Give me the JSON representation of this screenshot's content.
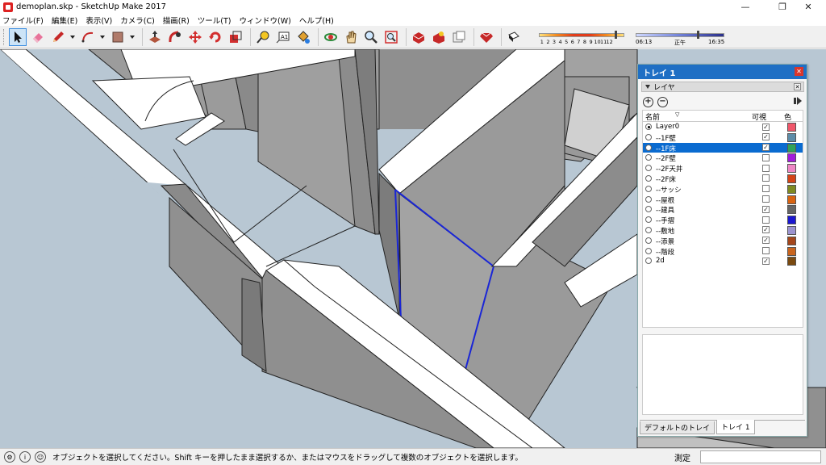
{
  "window": {
    "title": "demoplan.skp - SketchUp Make 2017",
    "minimize": "—",
    "restore": "❐",
    "close": "✕"
  },
  "menu": [
    "ファイル(F)",
    "編集(E)",
    "表示(V)",
    "カメラ(C)",
    "描画(R)",
    "ツール(T)",
    "ウィンドウ(W)",
    "ヘルプ(H)"
  ],
  "toolbar": {
    "tools": [
      "select-icon",
      "eraser-icon",
      "pencil-icon",
      "arc-icon",
      "shape-icon",
      "push-pull-icon",
      "follow-me-icon",
      "move-icon",
      "rotate-icon",
      "scale-icon",
      "tape-measure-icon",
      "text-icon",
      "paint-bucket-icon",
      "orbit-icon",
      "pan-icon",
      "zoom-icon",
      "zoom-extents-icon",
      "3d-warehouse-icon",
      "extension-warehouse-icon",
      "layout-icon",
      "ruby-icon",
      "shadows-icon"
    ],
    "shadow_months": [
      "1",
      "2",
      "3",
      "4",
      "5",
      "6",
      "7",
      "8",
      "9",
      "10",
      "11",
      "12"
    ],
    "time_start": "06:13",
    "time_mid": "正午",
    "time_end": "16:35"
  },
  "tray": {
    "title": "トレイ 1",
    "panel_title": "レイヤ",
    "columns": {
      "name": "名前",
      "visible": "可視",
      "color": "色"
    },
    "layers": [
      {
        "name": "Layer0",
        "active": true,
        "visible": true,
        "color": "#f0566a",
        "selected": false
      },
      {
        "name": "--1F壁",
        "active": false,
        "visible": true,
        "color": "#5d8ca8",
        "selected": false
      },
      {
        "name": "--1F床",
        "active": false,
        "visible": true,
        "color": "#2fa35a",
        "selected": true
      },
      {
        "name": "--2F壁",
        "active": false,
        "visible": false,
        "color": "#a21bdb",
        "selected": false
      },
      {
        "name": "--2F天井",
        "active": false,
        "visible": false,
        "color": "#ee86c5",
        "selected": false
      },
      {
        "name": "--2F床",
        "active": false,
        "visible": false,
        "color": "#d44418",
        "selected": false
      },
      {
        "name": "--サッシ",
        "active": false,
        "visible": false,
        "color": "#7f8a22",
        "selected": false
      },
      {
        "name": "--屋根",
        "active": false,
        "visible": false,
        "color": "#d86311",
        "selected": false
      },
      {
        "name": "--建具",
        "active": false,
        "visible": true,
        "color": "#656565",
        "selected": false
      },
      {
        "name": "--手摺",
        "active": false,
        "visible": false,
        "color": "#1b17d1",
        "selected": false
      },
      {
        "name": "--敷地",
        "active": false,
        "visible": true,
        "color": "#9b93cf",
        "selected": false
      },
      {
        "name": "--添景",
        "active": false,
        "visible": true,
        "color": "#a4461b",
        "selected": false
      },
      {
        "name": "--階段",
        "active": false,
        "visible": false,
        "color": "#c8641e",
        "selected": false
      },
      {
        "name": "2d",
        "active": false,
        "visible": true,
        "color": "#7a4a10",
        "selected": false
      }
    ],
    "tabs": [
      "デフォルトのトレイ",
      "トレイ 1"
    ]
  },
  "status": {
    "message": "オブジェクトを選択してください。Shift キーを押したまま選択するか、またはマウスをドラッグして複数のオブジェクトを選択します。",
    "measure_label": "測定",
    "measure_value": ""
  }
}
